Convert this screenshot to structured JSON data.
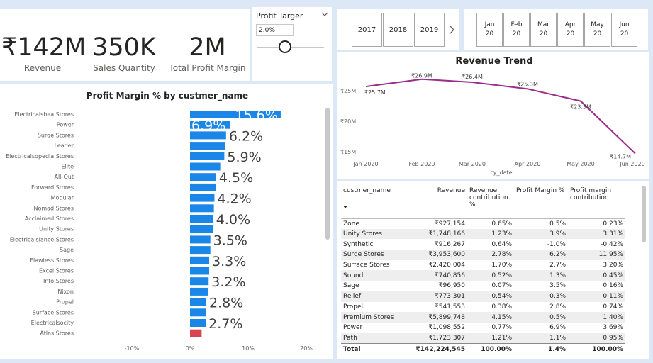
{
  "kpis": [
    {
      "value": "₹142M",
      "label": "Revenue"
    },
    {
      "value": "350K",
      "label": "Sales Quantity"
    },
    {
      "value": "2M",
      "label": "Total Profit Margin"
    }
  ],
  "profit_slicer": {
    "title": "Profit Targer",
    "input_value": "2.0%"
  },
  "year_buttons": [
    "2017",
    "2018",
    "2019"
  ],
  "month_buttons": [
    {
      "month": "Jan",
      "year": "20"
    },
    {
      "month": "Feb",
      "year": "20"
    },
    {
      "month": "Mar",
      "year": "20"
    },
    {
      "month": "Apr",
      "year": "20"
    },
    {
      "month": "May",
      "year": "20"
    },
    {
      "month": "Jun",
      "year": "20"
    }
  ],
  "bar_chart_title": "Profit Margin % by custmer_name",
  "trend_title": "Revenue Trend",
  "table": {
    "headers": [
      "custmer_name",
      "Revenue",
      "Revenue contribution %",
      "Profit Margin %",
      "Profit margin contribution"
    ],
    "rows": [
      [
        "Zone",
        "₹927,154",
        "0.65%",
        "0.5%",
        "0.23%"
      ],
      [
        "Unity Stores",
        "₹1,748,166",
        "1.23%",
        "3.9%",
        "3.31%"
      ],
      [
        "Synthetic",
        "₹916,267",
        "0.64%",
        "-1.0%",
        "-0.42%"
      ],
      [
        "Surge Stores",
        "₹3,953,600",
        "2.78%",
        "6.2%",
        "11.95%"
      ],
      [
        "Surface Stores",
        "₹2,420,004",
        "1.70%",
        "2.7%",
        "3.20%"
      ],
      [
        "Sound",
        "₹740,856",
        "0.52%",
        "1.3%",
        "0.45%"
      ],
      [
        "Sage",
        "₹96,950",
        "0.07%",
        "3.5%",
        "0.16%"
      ],
      [
        "Relief",
        "₹773,301",
        "0.54%",
        "0.3%",
        "0.11%"
      ],
      [
        "Propel",
        "₹541,553",
        "0.38%",
        "2.8%",
        "0.74%"
      ],
      [
        "Premium Stores",
        "₹5,899,748",
        "4.15%",
        "0.5%",
        "1.40%"
      ],
      [
        "Power",
        "₹1,098,552",
        "0.77%",
        "6.9%",
        "3.69%"
      ],
      [
        "Path",
        "₹1,723,307",
        "1.21%",
        "1.1%",
        "0.95%"
      ]
    ],
    "total": [
      "Total",
      "₹142,224,545",
      "100.00%",
      "1.4%",
      "100.00%"
    ]
  },
  "chart_data": [
    {
      "type": "bar",
      "title": "Profit Margin % by custmer_name",
      "orientation": "horizontal",
      "categories": [
        "Electricalsbea Stores",
        "Power",
        "Surge Stores",
        "Leader",
        "Electricalsopedia Stores",
        "Elite",
        "All-Out",
        "Forward Stores",
        "Modular",
        "Nomad Stores",
        "Acclaimed Stores",
        "Unity Stores",
        "Electricalslance Stores",
        "Sage",
        "Flawless Stores",
        "Excel Stores",
        "Info Stores",
        "Nixon",
        "Propel",
        "Surface Stores",
        "Electricalsocity",
        "Atlas Stores"
      ],
      "values": [
        15.6,
        6.9,
        6.2,
        6.0,
        5.9,
        5.2,
        4.5,
        4.4,
        4.2,
        4.1,
        4.0,
        3.9,
        3.5,
        3.5,
        3.3,
        3.3,
        3.2,
        3.1,
        2.8,
        2.7,
        2.7,
        2.0
      ],
      "data_labels": {
        "Electricalsbea Stores": "15.6%",
        "Power": "6.9%",
        "Surge Stores": "6.2%",
        "Electricalsopedia Stores": "5.9%",
        "All-Out": "4.5%",
        "Modular": "4.2%",
        "Acclaimed Stores": "4.0%",
        "Electricalslance Stores": "3.5%",
        "Flawless Stores": "3.3%",
        "Info Stores": "3.2%",
        "Propel": "2.8%",
        "Electricalsocity": "2.7%"
      },
      "xticks": [
        "-10%",
        "0%",
        "10%",
        "20%"
      ],
      "xlim": [
        -10,
        20
      ],
      "colors": {
        "default": "#1a86e8",
        "below_target": "#d64550"
      }
    },
    {
      "type": "line",
      "title": "Revenue Trend",
      "xlabel": "cy_date",
      "x": [
        "Jan 2020",
        "Feb 2020",
        "Mar 2020",
        "Apr 2020",
        "May 2020",
        "Jun 2020"
      ],
      "values": [
        25.7,
        26.9,
        26.4,
        25.3,
        23.3,
        14.7
      ],
      "data_labels": [
        "₹25.7M",
        "₹26.9M",
        "₹26.4M",
        "₹25.3M",
        "₹23.3M",
        "₹14.7M"
      ],
      "yticks": [
        "₹15M",
        "₹20M",
        "₹25M"
      ],
      "ylim": [
        14.7,
        26.9
      ],
      "color": "#9b2c8b"
    }
  ]
}
